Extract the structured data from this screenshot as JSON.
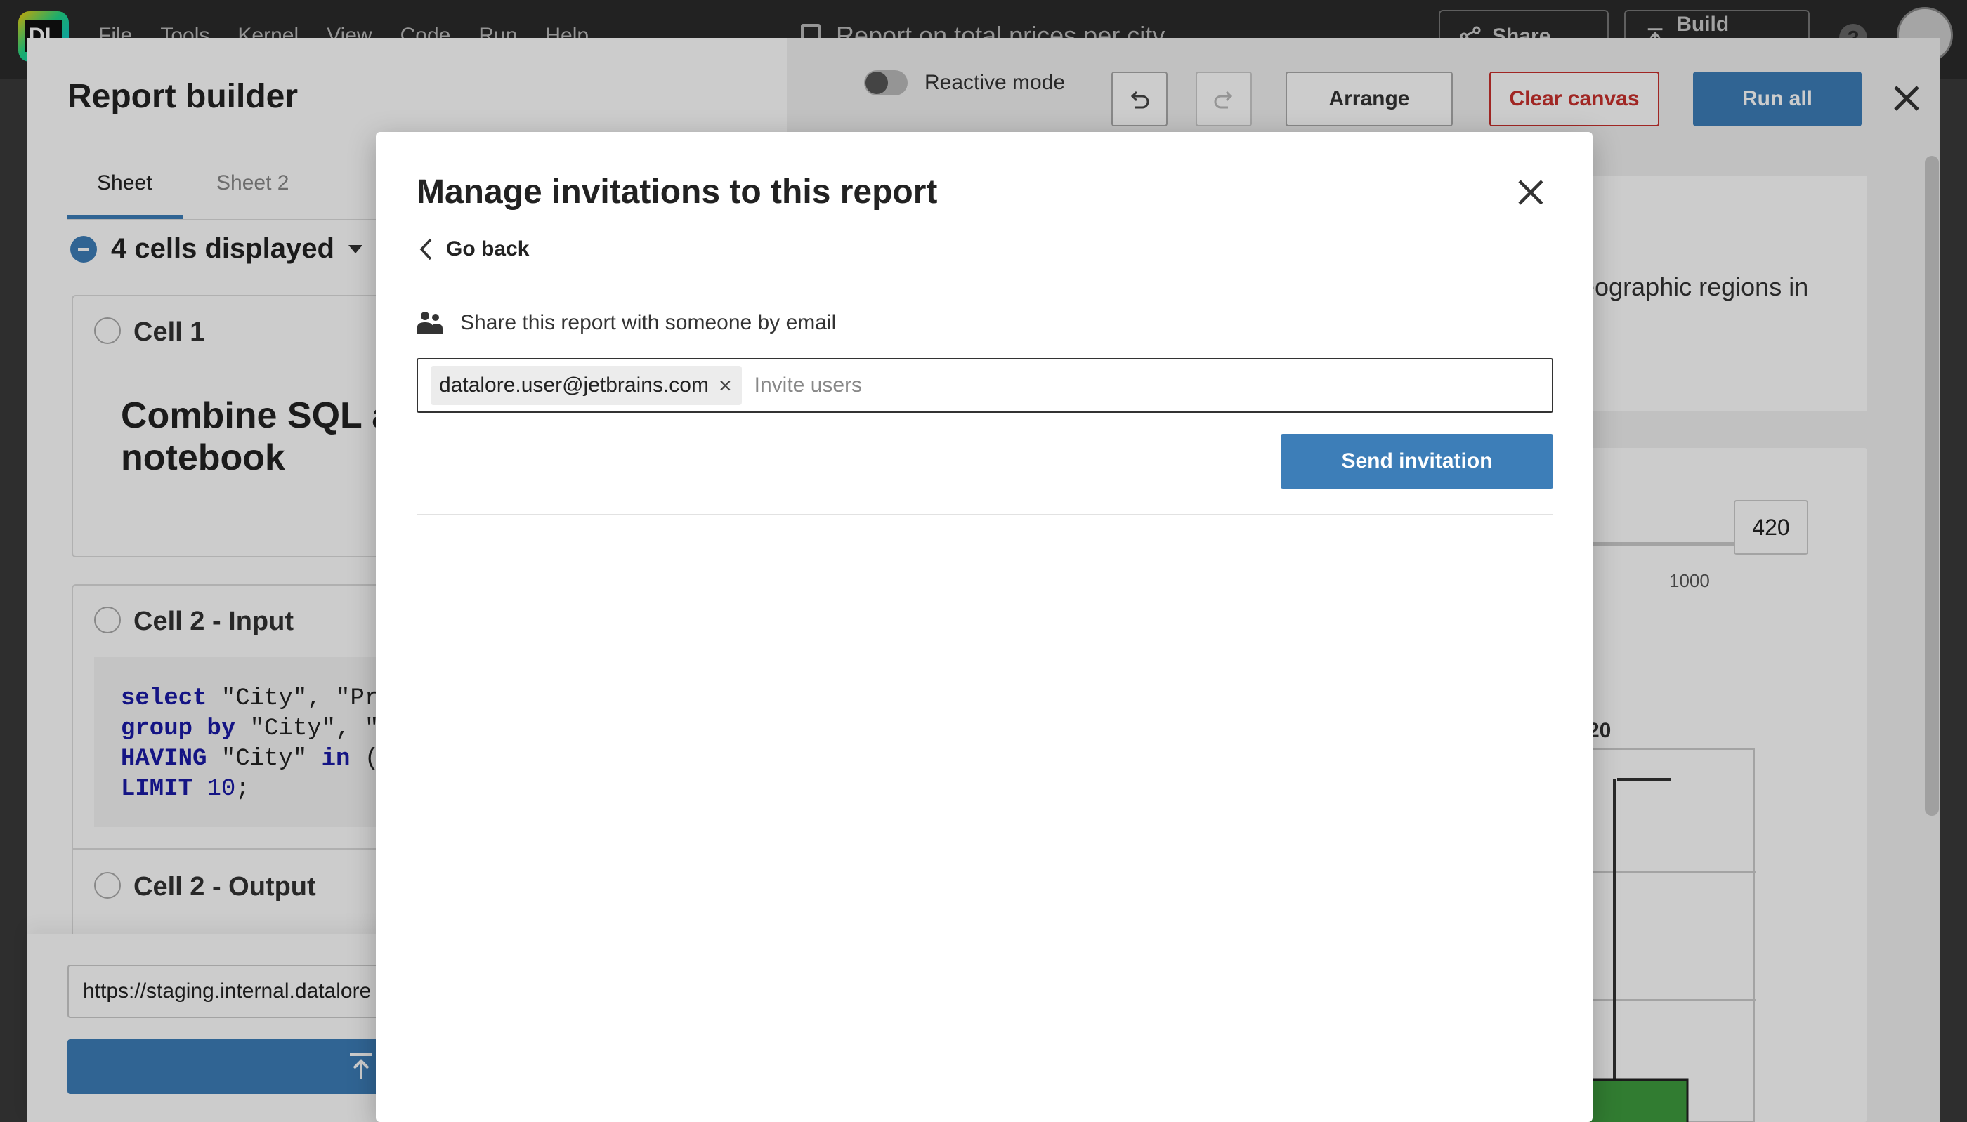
{
  "app": {
    "logo_text": "DL",
    "menu": [
      "File",
      "Tools",
      "Kernel",
      "View",
      "Code",
      "Run",
      "Help"
    ],
    "document_title": "Report on total prices per city",
    "share_label": "Share",
    "build_report_label": "Build report",
    "help_label": "?"
  },
  "builder": {
    "title": "Report builder",
    "tabs": [
      "Sheet",
      "Sheet 2"
    ],
    "cells_toggle": "4 cells displayed",
    "cells": {
      "cell1_title": "Cell 1",
      "cell1_heading": "Combine SQL ar notebook",
      "cell2_title": "Cell 2 - Input",
      "cell3_title": "Cell 2 - Output"
    },
    "url_value": "https://staging.internal.datalore",
    "upload_label": "Up",
    "toolbar": {
      "reactive_label": "Reactive mode",
      "arrange_label": "Arrange",
      "clear_label": "Clear canvas",
      "run_label": "Run all"
    },
    "preview": {
      "text": "eographic regions in",
      "slider_max": "1000",
      "input_value": "420",
      "chart_label": "20"
    }
  },
  "modal": {
    "title": "Manage invitations to this report",
    "go_back": "Go back",
    "share_text": "Share this report with someone by email",
    "chip_email": "datalore.user@jetbrains.com",
    "chip_remove": "×",
    "invite_placeholder": "Invite users",
    "send_label": "Send invitation"
  },
  "colors": {
    "accent": "#3d7eb8",
    "danger": "#c9302c",
    "topbar": "#2b2b2b"
  }
}
